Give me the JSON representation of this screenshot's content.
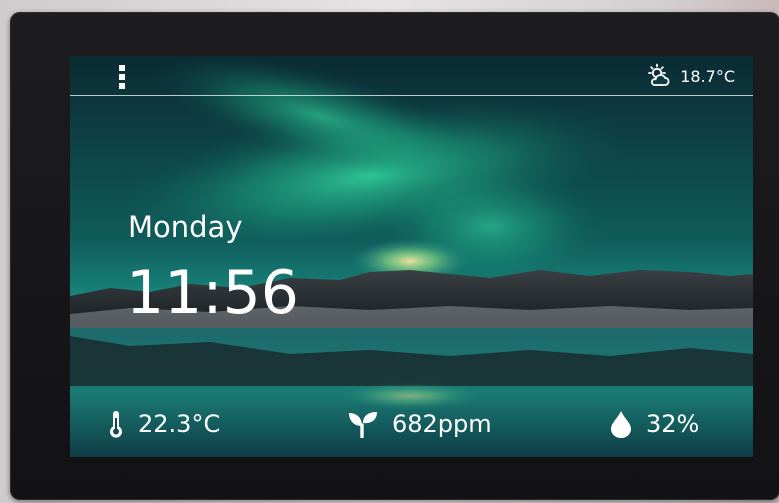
{
  "header": {
    "menu_icon": "menu-icon",
    "weather_icon": "partly-cloudy-icon",
    "outdoor_temperature": "18.7°C"
  },
  "clock": {
    "day": "Monday",
    "time": "11:56"
  },
  "sensors": [
    {
      "icon": "thermometer-icon",
      "value": "22.3°C"
    },
    {
      "icon": "sprout-icon",
      "value": "682ppm"
    },
    {
      "icon": "water-drop-icon",
      "value": "32%"
    }
  ],
  "colors": {
    "text": "#ffffff",
    "device_bezel": "#1a1a1c",
    "aurora_green": "#2fe0a6",
    "water_teal": "#1d6f70"
  }
}
